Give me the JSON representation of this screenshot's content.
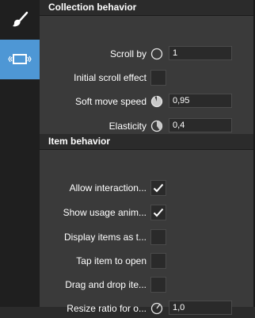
{
  "rail": {
    "items": [
      {
        "name": "brush-icon",
        "active": false
      },
      {
        "name": "view-icon",
        "active": true
      }
    ],
    "accent": "#4e97d5"
  },
  "collection": {
    "title": "Collection behavior",
    "scroll_by": {
      "label": "Scroll by",
      "value": "1"
    },
    "initial_scroll_effect": {
      "label": "Initial scroll effect",
      "checked": false
    },
    "soft_move_speed": {
      "label": "Soft move speed",
      "value": "0,95",
      "level": 0.95
    },
    "elasticity": {
      "label": "Elasticity",
      "value": "0,4",
      "level": 0.4
    }
  },
  "item": {
    "title": "Item behavior",
    "allow_interaction": {
      "label": "Allow interaction...",
      "checked": true
    },
    "show_usage_anim": {
      "label": "Show usage anim...",
      "checked": true
    },
    "display_items_as": {
      "label": "Display items as t...",
      "checked": false
    },
    "tap_item_to_open": {
      "label": "Tap item to open",
      "checked": false
    },
    "drag_and_drop": {
      "label": "Drag and drop ite...",
      "checked": false
    },
    "resize_ratio": {
      "label": "Resize ratio for o...",
      "value": "1,0"
    }
  }
}
